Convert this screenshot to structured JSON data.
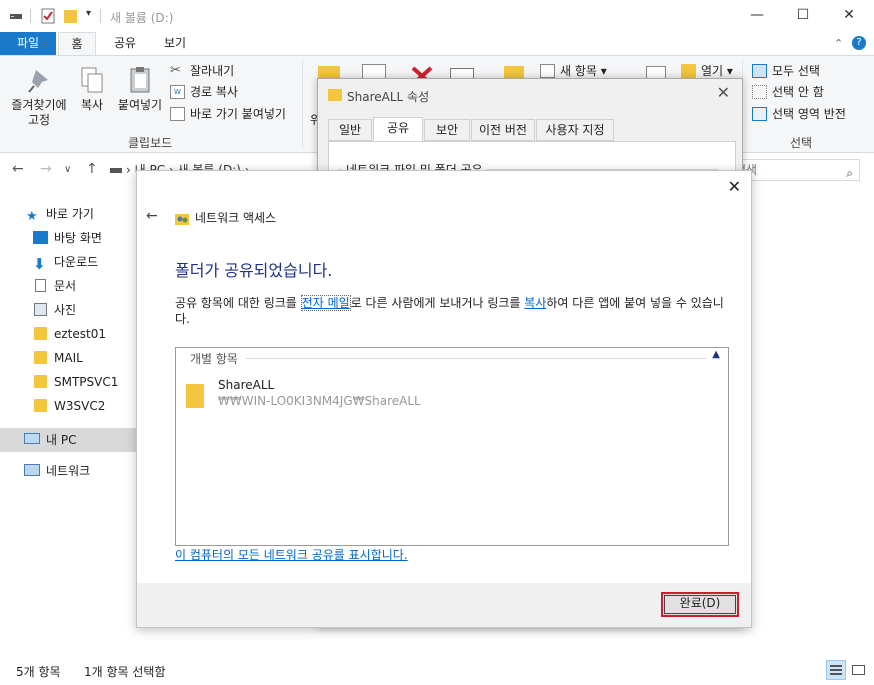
{
  "window": {
    "title": "새 볼륨 (D:)",
    "controls": {
      "minimize": "—",
      "maximize": "☐",
      "close": "✕"
    }
  },
  "ribbon_tabs": [
    "파일",
    "홈",
    "공유",
    "보기"
  ],
  "ribbon": {
    "pin_label_1": "즐겨찾기에",
    "pin_label_2": "고정",
    "copy": "복사",
    "paste": "붙여넣기",
    "cut": "잘라내기",
    "copy_path": "경로 복사",
    "paste_shortcut": "바로 가기 붙여넣기",
    "clipboard_group": "클립보드",
    "new_item": "새 항목 ▾",
    "open": "열기 ▾",
    "select_all": "모두 선택",
    "select_none": "선택 안 함",
    "invert_selection": "선택 영역 반전",
    "select_group": "선택",
    "partial_o": "위"
  },
  "address": {
    "path": "› 내 PC › 새 볼륨 (D:) ›",
    "search_placeholder": "검색"
  },
  "nav": {
    "quick_access": "바로 가기",
    "desktop": "바탕 화면",
    "downloads": "다운로드",
    "documents": "문서",
    "pictures": "사진",
    "folder1": "eztest01",
    "folder2": "MAIL",
    "folder3": "SMTPSVC1",
    "folder4": "W3SVC2",
    "this_pc": "내 PC",
    "network": "네트워크"
  },
  "status": {
    "count": "5개 항목",
    "selected": "1개 항목 선택함"
  },
  "properties": {
    "title": "ShareALL 속성",
    "tabs": [
      "일반",
      "공유",
      "보안",
      "이전 버전",
      "사용자 지정"
    ],
    "group": "네트워크 파일 및 폴더 공유"
  },
  "share_dialog": {
    "title": "네트워크 액세스",
    "heading": "폴더가 공유되었습니다.",
    "desc_part1": "공유 항목에 대한 링크를 ",
    "email_link": "전자 메일",
    "desc_part2": "로 다른 사람에게 보내거나 링크를 ",
    "copy_link": "복사",
    "desc_part3": "하여 다른 앱에 붙여 넣을 수 있습니다.",
    "group_label": "개별 항목",
    "item_name": "ShareALL",
    "item_path": "₩₩WIN-LO0KI3NM4JG₩ShareALL",
    "show_all": "이 컴퓨터의 모든 네트워크 공유를 표시합니다.",
    "done": "완료(D)"
  },
  "colors": {
    "file_tab": "#1979ca",
    "heading": "#1e3287",
    "link": "#0066cc",
    "highlight_border": "#cc1f2e",
    "folder": "#f4c63d"
  }
}
